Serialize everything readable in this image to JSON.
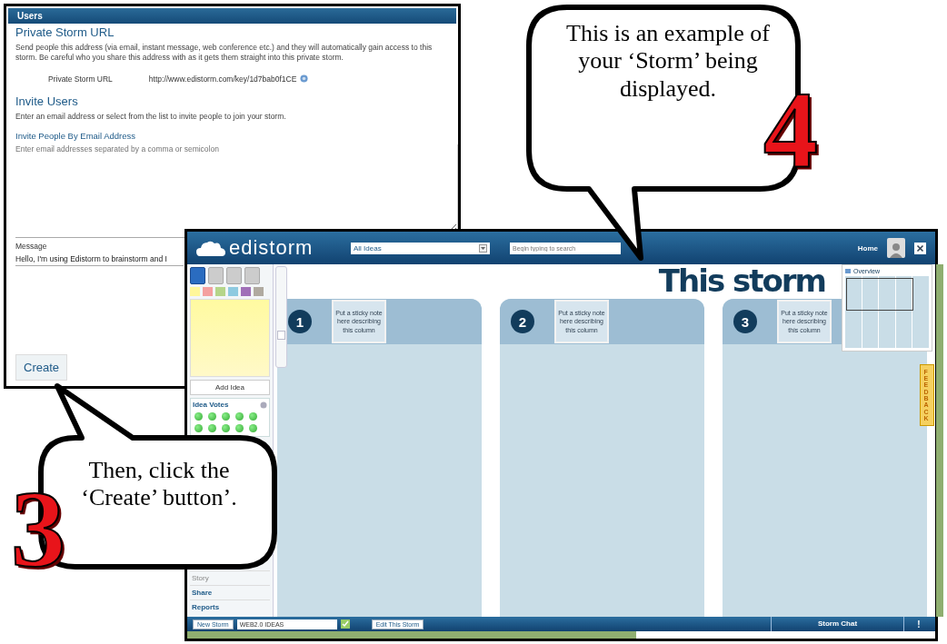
{
  "users_panel": {
    "title": "Users",
    "private_heading": "Private Storm URL",
    "private_description": "Send people this address (via email, instant message, web conference etc.) and they will automatically gain access to this storm. Be careful who you share this address with as it gets them straight into this private storm.",
    "url_label": "Private Storm URL",
    "url_value": "http://www.edistorm.com/key/1d7bab0f1CE",
    "invite_heading": "Invite Users",
    "invite_description": "Enter an email address or select from the list to invite people to join your storm.",
    "email_label": "Invite People By Email Address",
    "email_placeholder": "Enter email addresses separated by a comma or semicolon",
    "message_label": "Message",
    "message_value": "Hello, I'm using Edistorm to brainstorm and I",
    "create_button": "Create"
  },
  "edistorm": {
    "logo": "edistorm",
    "filter": "All Ideas",
    "search_placeholder": "Begin typing to search",
    "home": "Home",
    "storm_title": "This storm",
    "tools": [
      {
        "selected": true
      },
      {
        "selected": false
      },
      {
        "selected": false
      },
      {
        "selected": false
      }
    ],
    "swatches": [
      {
        "color": "#fff79a"
      },
      {
        "color": "#f4a0a0"
      },
      {
        "color": "#b5d58a"
      },
      {
        "color": "#8ecae0"
      },
      {
        "color": "#a070b8"
      },
      {
        "color": "#b0aaa0"
      }
    ],
    "zoom": {
      "level": 0.3
    },
    "add_idea": "Add Idea",
    "votes_title": "Idea Votes",
    "side_links": [
      "Story",
      "Share",
      "Reports"
    ],
    "columns": [
      {
        "number": "1",
        "note": "Put a sticky note here describing this column"
      },
      {
        "number": "2",
        "note": "Put a sticky note here describing this column"
      },
      {
        "number": "3",
        "note": "Put a sticky note here describing this column"
      }
    ],
    "minimap_title": "Overview",
    "feedback": "FEEDBACK",
    "new_storm": "New Storm",
    "storm_select": "WEB2.0 IDEAS",
    "edit_storm": "Edit This Storm",
    "storm_chat": "Storm Chat",
    "alert": "!"
  },
  "callouts": [
    {
      "text": "This is an example of your ‘Storm’ being displayed.",
      "step": "4"
    },
    {
      "text": "Then, click the ‘Create’ button’.",
      "step": "3"
    }
  ]
}
